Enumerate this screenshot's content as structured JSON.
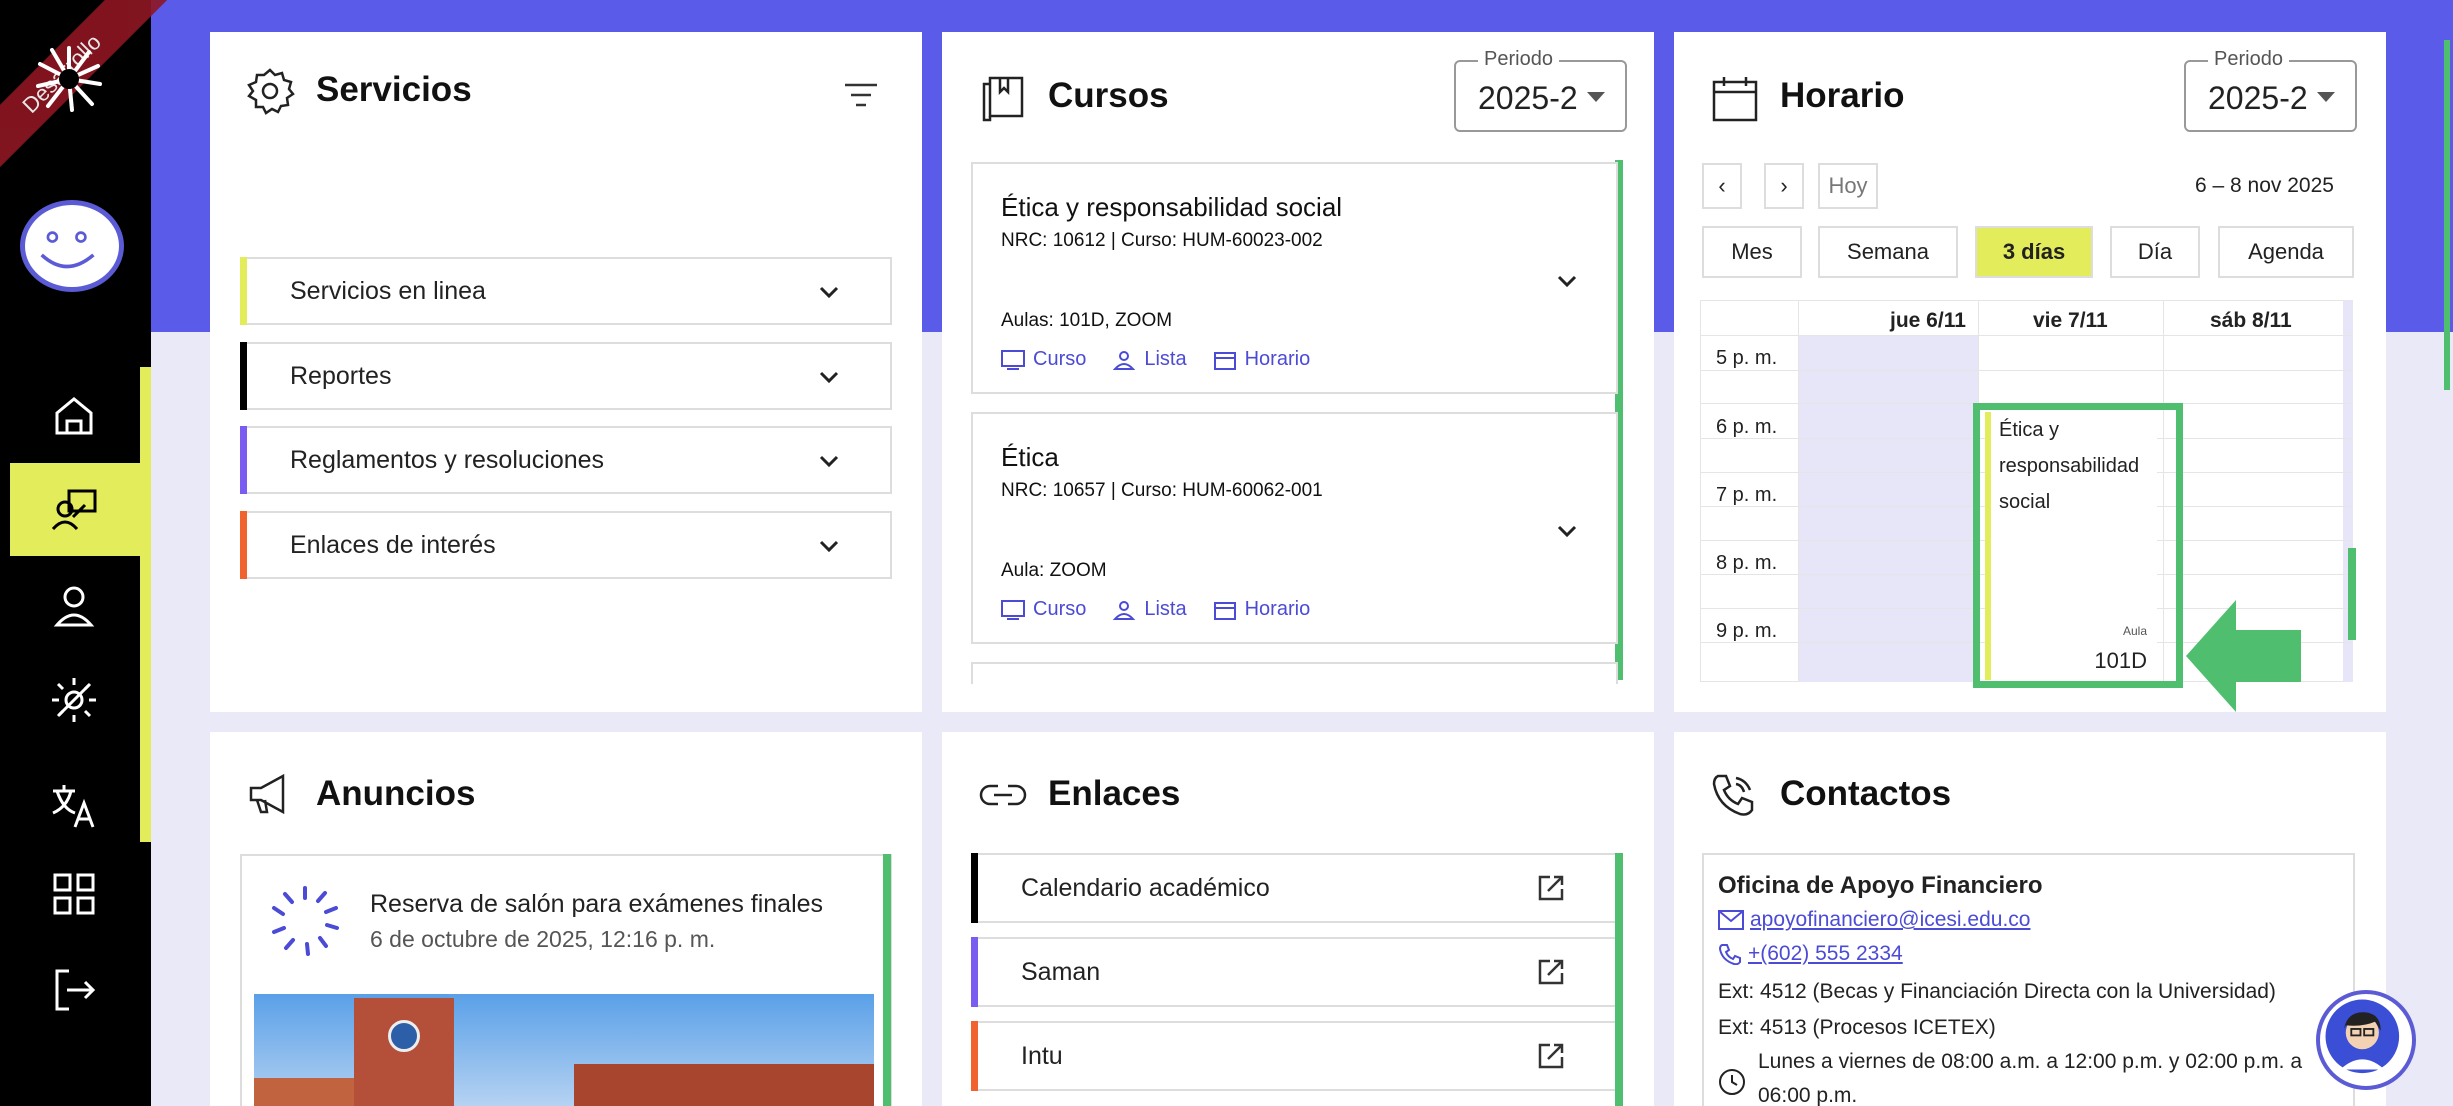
{
  "sidebar": {
    "ribbon": "Desarrollo",
    "nav": [
      {
        "icon": "home-icon"
      },
      {
        "icon": "teacher-icon"
      },
      {
        "icon": "user-icon"
      },
      {
        "icon": "brightness-icon"
      },
      {
        "icon": "translate-icon"
      },
      {
        "icon": "apps-icon"
      },
      {
        "icon": "logout-icon"
      }
    ]
  },
  "servicios": {
    "title": "Servicios",
    "items": [
      {
        "label": "Servicios en linea",
        "color": "#e3ec5b"
      },
      {
        "label": "Reportes",
        "color": "#000000"
      },
      {
        "label": "Reglamentos y resoluciones",
        "color": "#7b5cf0"
      },
      {
        "label": "Enlaces de interés",
        "color": "#f0622e"
      }
    ]
  },
  "cursos": {
    "title": "Cursos",
    "periodo_label": "Periodo",
    "periodo_value": "2025-2",
    "items": [
      {
        "name": "Ética y responsabilidad social",
        "nrc": "NRC: 10612 | Curso: HUM-60023-002",
        "aula": "Aulas: 101D, ZOOM"
      },
      {
        "name": "Ética",
        "nrc": "NRC: 10657 | Curso: HUM-60062-001",
        "aula": "Aula: ZOOM"
      }
    ],
    "link_curso": "Curso",
    "link_lista": "Lista",
    "link_horario": "Horario"
  },
  "horario": {
    "title": "Horario",
    "periodo_label": "Periodo",
    "periodo_value": "2025-2",
    "prev": "‹",
    "next": "›",
    "hoy": "Hoy",
    "range": "6 – 8 nov 2025",
    "views": [
      "Mes",
      "Semana",
      "3 días",
      "Día",
      "Agenda"
    ],
    "active_view": "3 días",
    "days": [
      "jue 6/11",
      "vie 7/11",
      "sáb 8/11"
    ],
    "times": [
      "5 p. m.",
      "6 p. m.",
      "7 p. m.",
      "8 p. m.",
      "9 p. m."
    ],
    "event": {
      "title_1": "Ética y",
      "title_2": "responsabilidad",
      "title_3": "social",
      "aula_label": "Aula",
      "aula": "101D"
    }
  },
  "anuncios": {
    "title": "Anuncios",
    "item_title": "Reserva de salón para exámenes finales",
    "item_date": "6 de octubre de 2025, 12:16 p. m."
  },
  "enlaces": {
    "title": "Enlaces",
    "items": [
      {
        "label": "Calendario académico",
        "color": "#000000"
      },
      {
        "label": "Saman",
        "color": "#7b5cf0"
      },
      {
        "label": "Intu",
        "color": "#f0622e"
      }
    ]
  },
  "contactos": {
    "title": "Contactos",
    "office": "Oficina de Apoyo Financiero",
    "email": "apoyofinanciero@icesi.edu.co",
    "phone": "+(602) 555 2334",
    "ext1": "Ext: 4512 (Becas y Financiación Directa con la Universidad)",
    "ext2": "Ext: 4513 (Procesos ICETEX)",
    "hours_1": "Lunes a viernes de 08:00 a.m. a 12:00 p.m. y 02:00 p.m. a",
    "hours_2": "06:00 p.m."
  },
  "colors": {
    "brand": "#5b5bea",
    "accent_yellow": "#e3ec5b",
    "green": "#4fbf6f",
    "link": "#4b4bd6"
  }
}
